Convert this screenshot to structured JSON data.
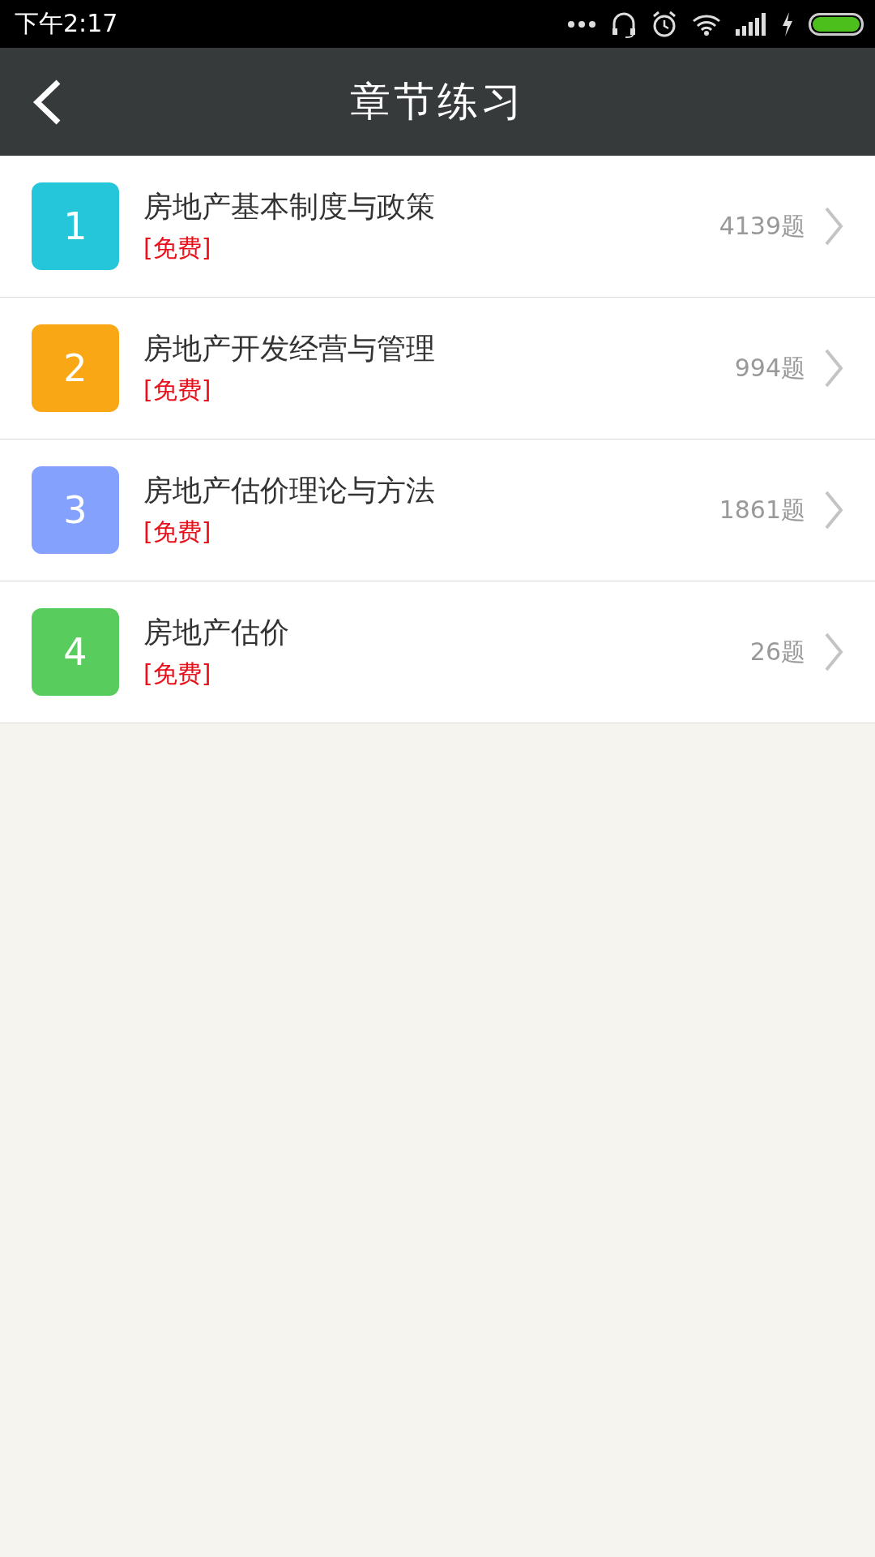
{
  "status_bar": {
    "time": "下午2:17"
  },
  "header": {
    "title": "章节练习"
  },
  "chapters": [
    {
      "number": "1",
      "title": "房地产基本制度与政策",
      "tag": "[免费]",
      "count": "4139题",
      "color": "#26c6da"
    },
    {
      "number": "2",
      "title": "房地产开发经营与管理",
      "tag": "[免费]",
      "count": "994题",
      "color": "#f9a714"
    },
    {
      "number": "3",
      "title": "房地产估价理论与方法",
      "tag": "[免费]",
      "count": "1861题",
      "color": "#84a2fd"
    },
    {
      "number": "4",
      "title": "房地产估价",
      "tag": "[免费]",
      "count": "26题",
      "color": "#58cc5c"
    }
  ]
}
